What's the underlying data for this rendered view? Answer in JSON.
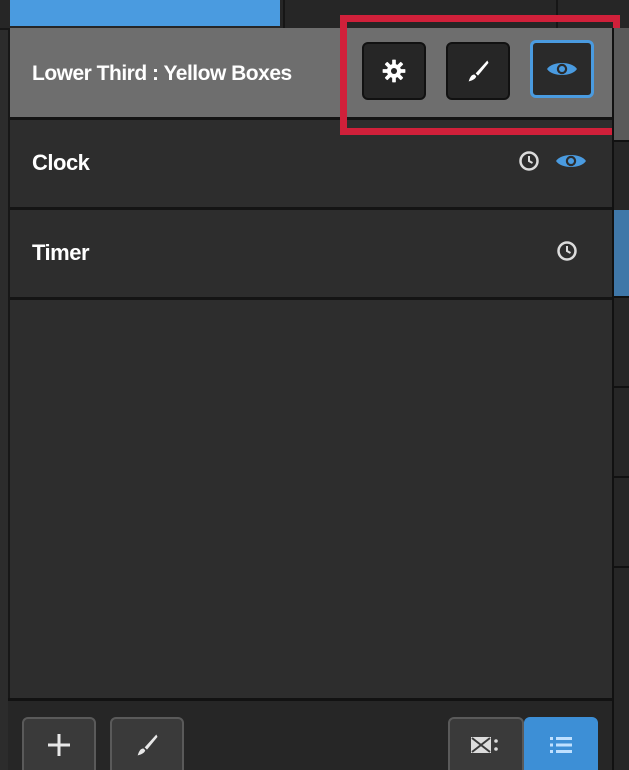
{
  "layers": {
    "selected": {
      "label": "Lower Third : Yellow Boxes",
      "actions": [
        {
          "icon": "gear-icon",
          "active": false
        },
        {
          "icon": "brush-icon",
          "active": false
        },
        {
          "icon": "eye-icon",
          "active": true
        }
      ]
    },
    "items": [
      {
        "label": "Clock",
        "icons": [
          "clock-icon",
          "eye-icon"
        ]
      },
      {
        "label": "Timer",
        "icons": [
          "clock-icon"
        ]
      }
    ]
  },
  "toolbar": {
    "add_icon": "plus-icon",
    "brush_icon": "brush-icon",
    "view_modes": [
      {
        "icon": "grid-view-icon",
        "active": false
      },
      {
        "icon": "list-view-icon",
        "active": true
      }
    ]
  },
  "colors": {
    "accent": "#4a9be0",
    "highlight": "#d0203a",
    "selected_row": "#6e6e6e"
  }
}
